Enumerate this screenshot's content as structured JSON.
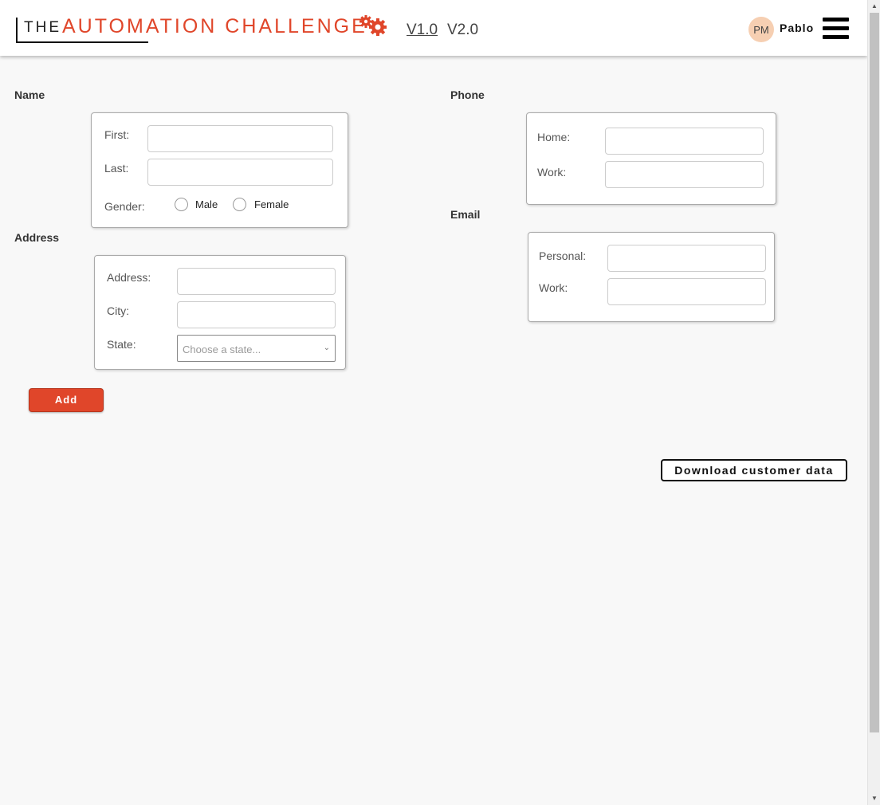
{
  "header": {
    "logo_the": "THE",
    "logo_title": "AUTOMATION CHALLENGE",
    "versions": [
      "V1.0",
      "V2.0"
    ],
    "avatar_initials": "PM",
    "username": "Pablo",
    "accent_color": "#e0462a"
  },
  "name": {
    "section_label": "Name",
    "first_label": "First:",
    "first_value": "",
    "last_label": "Last:",
    "last_value": "",
    "gender_label": "Gender:",
    "gender_options": [
      "Male",
      "Female"
    ]
  },
  "address": {
    "section_label": "Address",
    "address_label": "Address:",
    "address_value": "",
    "city_label": "City:",
    "city_value": "",
    "state_label": "State:",
    "state_placeholder": "Choose a state..."
  },
  "phone": {
    "section_label": "Phone",
    "home_label": "Home:",
    "home_value": "",
    "work_label": "Work:",
    "work_value": ""
  },
  "email": {
    "section_label": "Email",
    "personal_label": "Personal:",
    "personal_value": "",
    "work_label": "Work:",
    "work_value": ""
  },
  "actions": {
    "add_label": "Add",
    "download_label": "Download customer data"
  }
}
